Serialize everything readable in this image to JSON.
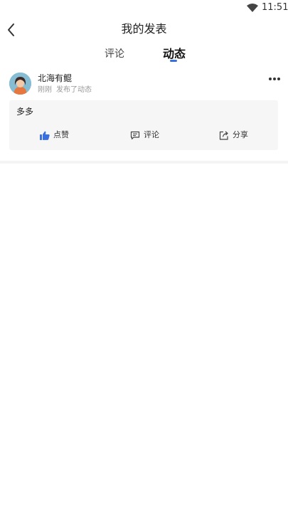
{
  "status_bar": {
    "time": "11:51",
    "wifi_icon": "wifi-icon"
  },
  "nav": {
    "back_icon": "chevron-left-icon",
    "title": "我的发表"
  },
  "tabs": [
    {
      "label": "评论",
      "active": false
    },
    {
      "label": "动态",
      "active": true
    }
  ],
  "post": {
    "author": "北海有鲲",
    "time": "刚刚",
    "action": "发布了动态",
    "content": "多多",
    "actions": {
      "like": {
        "label": "点赞",
        "icon": "thumbs-up-icon"
      },
      "comment": {
        "label": "评论",
        "icon": "comment-icon"
      },
      "share": {
        "label": "分享",
        "icon": "share-icon"
      }
    }
  },
  "colors": {
    "accent": "#3a6fe0",
    "card_bg": "#f6f6f7"
  }
}
